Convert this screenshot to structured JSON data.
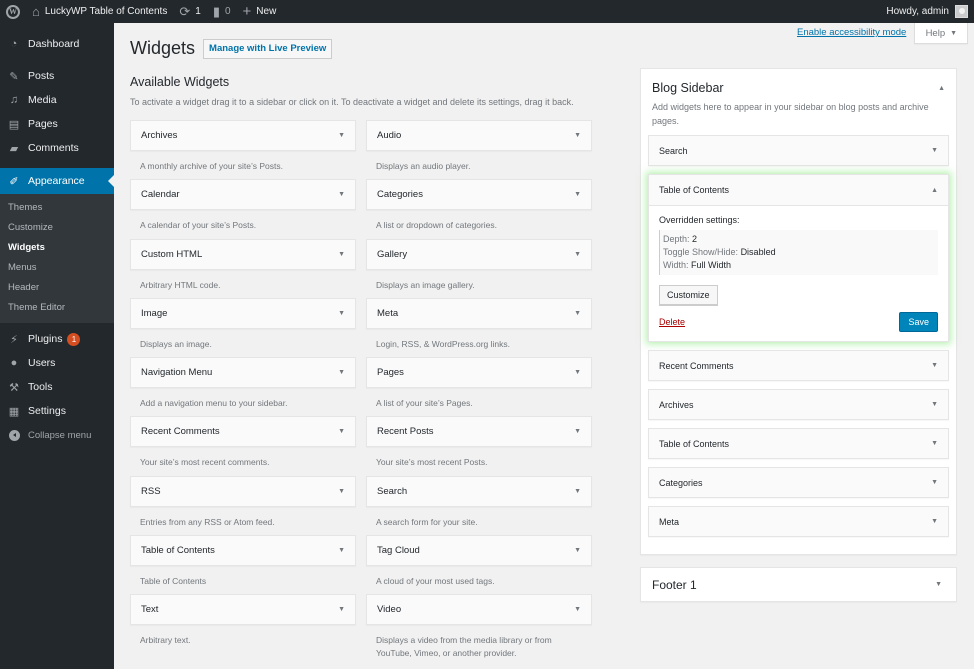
{
  "admin_bar": {
    "wp_logo": "wordpress-logo-icon",
    "site_name": "LuckyWP Table of Contents",
    "updates_count": "1",
    "comments_count": "0",
    "new_label": "New",
    "greeting": "Howdy, admin"
  },
  "menu": {
    "items": [
      {
        "label": "Dashboard",
        "icon": "dashboard-icon"
      },
      {
        "label": "Posts",
        "icon": "pin-icon"
      },
      {
        "label": "Media",
        "icon": "media-icon"
      },
      {
        "label": "Pages",
        "icon": "pages-icon"
      },
      {
        "label": "Comments",
        "icon": "comment-icon"
      },
      {
        "label": "Appearance",
        "icon": "paintbrush-icon"
      }
    ],
    "appearance_submenu": [
      "Themes",
      "Customize",
      "Widgets",
      "Menus",
      "Header",
      "Theme Editor"
    ],
    "lower_items": [
      {
        "label": "Plugins",
        "icon": "plugin-icon",
        "badge": "1"
      },
      {
        "label": "Users",
        "icon": "user-icon"
      },
      {
        "label": "Tools",
        "icon": "wrench-icon"
      },
      {
        "label": "Settings",
        "icon": "settings-icon"
      }
    ],
    "collapse_label": "Collapse menu"
  },
  "screen_meta": {
    "accessibility_link": "Enable accessibility mode",
    "help_label": "Help"
  },
  "page": {
    "title": "Widgets",
    "live_preview_button": "Manage with Live Preview",
    "available_title": "Available Widgets",
    "available_desc": "To activate a widget drag it to a sidebar or click on it. To deactivate a widget and delete its settings, drag it back."
  },
  "available_widgets": [
    {
      "title": "Archives",
      "desc": "A monthly archive of your site’s Posts."
    },
    {
      "title": "Audio",
      "desc": "Displays an audio player."
    },
    {
      "title": "Calendar",
      "desc": "A calendar of your site’s Posts."
    },
    {
      "title": "Categories",
      "desc": "A list or dropdown of categories."
    },
    {
      "title": "Custom HTML",
      "desc": "Arbitrary HTML code."
    },
    {
      "title": "Gallery",
      "desc": "Displays an image gallery."
    },
    {
      "title": "Image",
      "desc": "Displays an image."
    },
    {
      "title": "Meta",
      "desc": "Login, RSS, & WordPress.org links."
    },
    {
      "title": "Navigation Menu",
      "desc": "Add a navigation menu to your sidebar."
    },
    {
      "title": "Pages",
      "desc": "A list of your site’s Pages."
    },
    {
      "title": "Recent Comments",
      "desc": "Your site’s most recent comments."
    },
    {
      "title": "Recent Posts",
      "desc": "Your site’s most recent Posts."
    },
    {
      "title": "RSS",
      "desc": "Entries from any RSS or Atom feed."
    },
    {
      "title": "Search",
      "desc": "A search form for your site."
    },
    {
      "title": "Table of Contents",
      "desc": "Table of Contents"
    },
    {
      "title": "Tag Cloud",
      "desc": "A cloud of your most used tags."
    },
    {
      "title": "Text",
      "desc": "Arbitrary text."
    },
    {
      "title": "Video",
      "desc": "Displays a video from the media library or from YouTube, Vimeo, or another provider."
    }
  ],
  "blog_sidebar": {
    "title": "Blog Sidebar",
    "desc": "Add widgets here to appear in your sidebar on blog posts and archive pages.",
    "widgets_before": [
      "Search"
    ],
    "open_widget": {
      "title": "Table of Contents",
      "overridden_label": "Overridden settings:",
      "settings": [
        {
          "key": "Depth:",
          "value": "2"
        },
        {
          "key": "Toggle Show/Hide:",
          "value": "Disabled"
        },
        {
          "key": "Width:",
          "value": "Full Width"
        }
      ],
      "customize_button": "Customize",
      "delete_link": "Delete",
      "save_button": "Save"
    },
    "widgets_after": [
      "Recent Comments",
      "Archives",
      "Table of Contents",
      "Categories",
      "Meta"
    ]
  },
  "footer_sidebar": {
    "title": "Footer 1"
  },
  "colors": {
    "admin_bar": "#23282d",
    "menu_current": "#0073aa",
    "primary_button": "#0085ba",
    "delete": "#a00",
    "badge": "#d54e21",
    "highlight_glow": "#78e66e"
  }
}
